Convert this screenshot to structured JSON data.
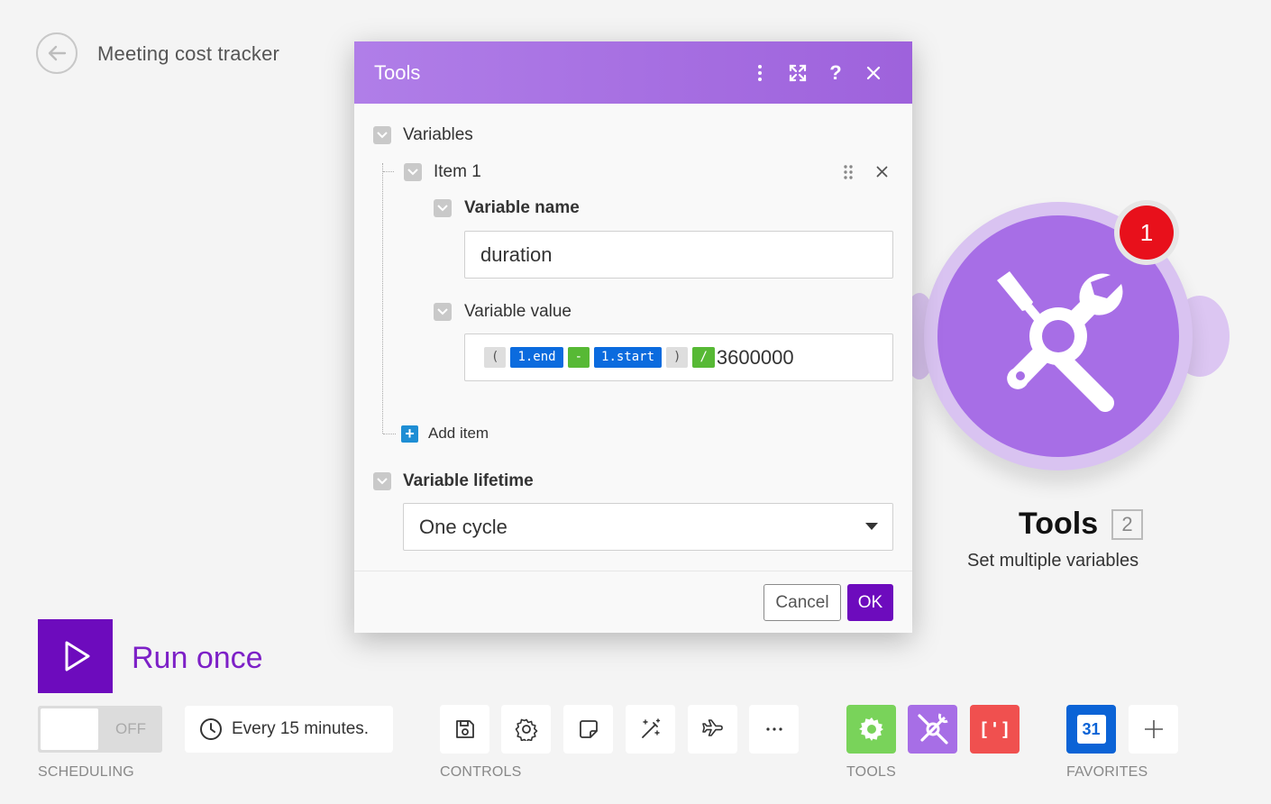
{
  "scenario": {
    "title": "Meeting cost tracker"
  },
  "module": {
    "name": "Tools",
    "id": "2",
    "description": "Set multiple variables",
    "badge": "1",
    "color": "#a76ee6"
  },
  "run": {
    "label": "Run once"
  },
  "scheduling": {
    "toggle_text": "OFF",
    "interval": "Every 15 minutes.",
    "section_label": "SCHEDULING"
  },
  "controls": {
    "section_label": "CONTROLS"
  },
  "tools": {
    "section_label": "TOOLS",
    "error_handler_label": "[']"
  },
  "favorites": {
    "section_label": "FAVORITES",
    "calendar_day": "31"
  },
  "dialog": {
    "title": "Tools",
    "variables_label": "Variables",
    "item_label": "Item 1",
    "variable_name_label": "Variable name",
    "variable_name_value": "duration",
    "variable_value_label": "Variable value",
    "formula": {
      "open_paren": "(",
      "end_token": "1.end",
      "minus": "-",
      "start_token": "1.start",
      "close_paren": ")",
      "divide": "/",
      "divisor": "3600000"
    },
    "add_item_label": "Add item",
    "lifetime_label": "Variable lifetime",
    "lifetime_value": "One cycle",
    "cancel_label": "Cancel",
    "ok_label": "OK"
  },
  "colors": {
    "accent_purple": "#6d0bbd",
    "header_purple": "#a76ee6",
    "pill_blue": "#0b6bde",
    "pill_green": "#57b935",
    "badge_red": "#e8101b"
  }
}
